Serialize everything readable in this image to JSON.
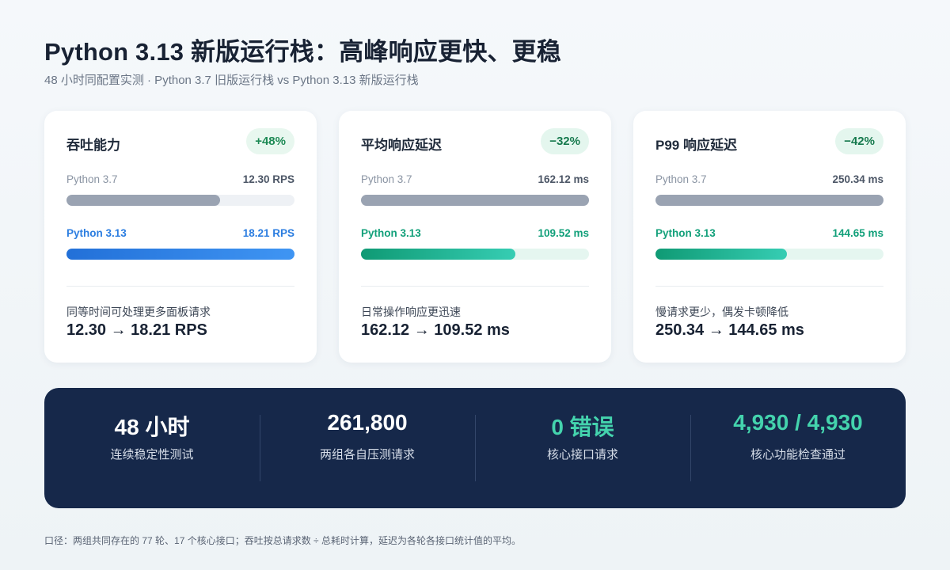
{
  "header": {
    "title": "Python 3.13 新版运行栈：高峰响应更快、更稳",
    "subtitle": "48 小时同配置实测 · Python 3.7 旧版运行栈 vs Python 3.13 新版运行栈"
  },
  "cards": [
    {
      "title": "吞吐能力",
      "badge": "+48%",
      "old_label": "Python 3.7",
      "old_value": "12.30 RPS",
      "old_fraction": 0.675,
      "new_label": "Python 3.13",
      "new_value": "18.21 RPS",
      "new_fraction": 1.0,
      "note": "同等时间可处理更多面板请求",
      "compare": "12.30 → 18.21 RPS",
      "accent": "#2b7de0"
    },
    {
      "title": "平均响应延迟",
      "badge": "−32%",
      "old_label": "Python 3.7",
      "old_value": "162.12 ms",
      "old_fraction": 1.0,
      "new_label": "Python 3.13",
      "new_value": "109.52 ms",
      "new_fraction": 0.676,
      "note": "日常操作响应更迅速",
      "compare": "162.12 → 109.52 ms",
      "accent": "#12a07a"
    },
    {
      "title": "P99 响应延迟",
      "badge": "−42%",
      "old_label": "Python 3.7",
      "old_value": "250.34 ms",
      "old_fraction": 1.0,
      "new_label": "Python 3.13",
      "new_value": "144.65 ms",
      "new_fraction": 0.578,
      "note": "慢请求更少，偶发卡顿降低",
      "compare": "250.34 → 144.65 ms",
      "accent": "#12a07a"
    }
  ],
  "stats": [
    {
      "value": "48 小时",
      "label": "连续稳定性测试",
      "highlight": false
    },
    {
      "value": "261,800",
      "label": "两组各自压测请求",
      "highlight": false
    },
    {
      "value": "0 错误",
      "label": "核心接口请求",
      "highlight": true
    },
    {
      "value": "4,930 / 4,930",
      "label": "核心功能检查通过",
      "highlight": true
    }
  ],
  "footnote": "口径：两组共同存在的 77 轮、17 个核心接口；吞吐按总请求数 ÷ 总耗时计算，延迟为各轮各接口统计值的平均。",
  "colors": {
    "blue_accent": "#2b7de0",
    "green_accent": "#12a07a",
    "panel_bg": "#16284a",
    "teal_highlight": "#44d3ad"
  }
}
